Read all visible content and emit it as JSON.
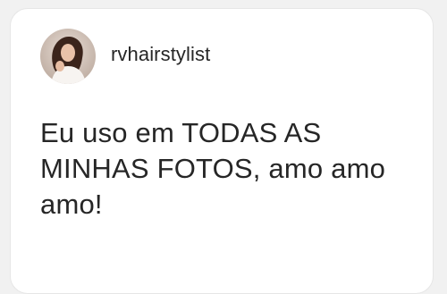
{
  "post": {
    "username": "rvhairstylist",
    "avatar_icon": "profile-photo",
    "message": "Eu uso em TODAS AS MINHAS FOTOS, amo amo amo!"
  },
  "colors": {
    "background": "#f1f1f1",
    "card": "#ffffff",
    "text": "#262626"
  }
}
